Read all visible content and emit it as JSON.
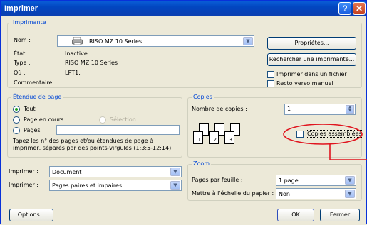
{
  "window": {
    "title": "Imprimer",
    "help": "?",
    "close": "✕"
  },
  "printer": {
    "legend": "Imprimante",
    "name_label": "Nom :",
    "name_value": "RISO MZ 10 Series",
    "status_label": "État :",
    "status_value": "Inactive",
    "type_label": "Type :",
    "type_value": "RISO MZ 10 Series",
    "where_label": "Où :",
    "where_value": "LPT1:",
    "comment_label": "Commentaire :",
    "properties_button": "Propriétés...",
    "find_button": "Rechercher une imprimante...",
    "print_to_file": "Imprimer dans un fichier",
    "duplex": "Recto verso manuel"
  },
  "range": {
    "legend": "Étendue de page",
    "all": "Tout",
    "current": "Page en cours",
    "selection": "Sélection",
    "pages": "Pages :",
    "hint": "Tapez les n° des pages et/ou étendues de page à imprimer, séparés par des points-virgules (1;3;5-12;14)."
  },
  "copies": {
    "legend": "Copies",
    "count_label": "Nombre de copies :",
    "count_value": "1",
    "collate": "Copies assemblées",
    "page_numbers": [
      "1",
      "2",
      "3"
    ]
  },
  "print_what": {
    "label": "Imprimer :",
    "value": "Document"
  },
  "print_which": {
    "label": "Imprimer :",
    "value": "Pages paires et impaires"
  },
  "zoom": {
    "legend": "Zoom",
    "pps_label": "Pages par feuille :",
    "pps_value": "1 page",
    "scale_label": "Mettre à l'échelle du papier :",
    "scale_value": "Non"
  },
  "buttons": {
    "options": "Options...",
    "ok": "OK",
    "close": "Fermer"
  },
  "colors": {
    "title_bar": "#0246c0",
    "legend_text": "#0046d5",
    "annotation": "#e0141e"
  }
}
